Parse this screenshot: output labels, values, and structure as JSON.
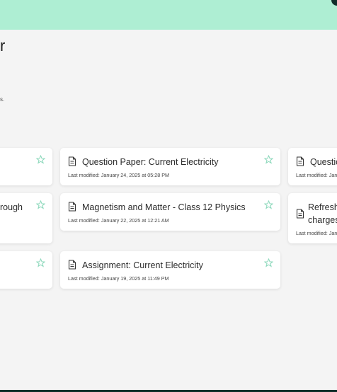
{
  "header": {
    "title_fragment": "r",
    "desc_fragment": "s."
  },
  "cards": [
    {
      "title": "Question Paper: Current Electricity",
      "meta": "Last modified: January 24, 2025 at 05:28 PM"
    },
    {
      "title": "Magnetism and Matter - Class 12 Physics",
      "meta": "Last modified: January 22, 2025 at 12:21 AM"
    },
    {
      "title": "Assignment: Current Electricity",
      "meta": "Last modified: January 19, 2025 at 11:49 PM"
    },
    {
      "title": "Questic",
      "meta": "Last modified: Jan"
    },
    {
      "title_line1": "Refresh",
      "title_line2": "charges",
      "meta": "Last modified: Janu"
    },
    {
      "title": "rough"
    }
  ],
  "colors": {
    "accent": "#aeeed3",
    "star": "#8fd9bd",
    "dark": "#0f2e2a"
  },
  "icons": [
    "document-icon",
    "star-icon"
  ]
}
